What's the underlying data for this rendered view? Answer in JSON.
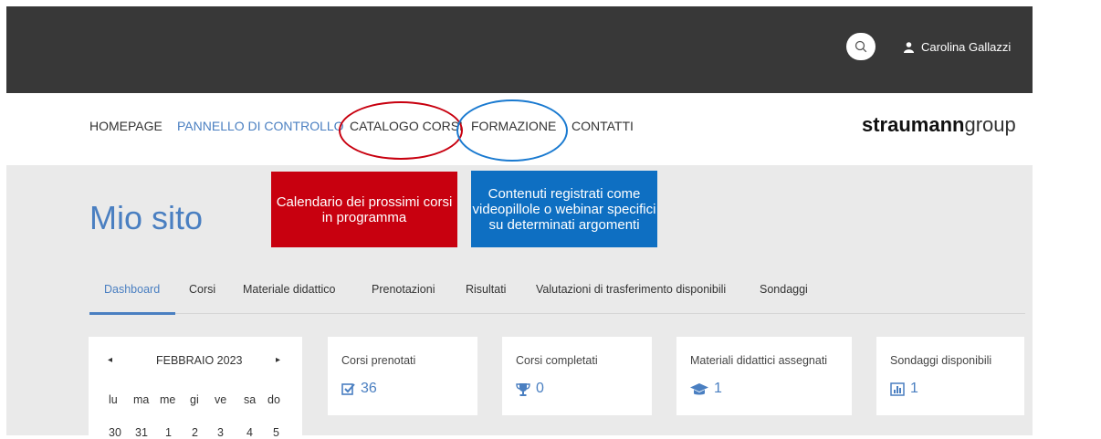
{
  "header": {
    "user_name": "Carolina Gallazzi"
  },
  "nav": {
    "items": [
      "HOMEPAGE",
      "PANNELLO DI CONTROLLO",
      "CATALOGO CORSI",
      "FORMAZIONE",
      "CONTATTI"
    ]
  },
  "logo": {
    "bold": "straumann",
    "light": "group"
  },
  "page": {
    "title": "Mio sito"
  },
  "annotations": {
    "red": "Calendario dei prossimi corsi in programma",
    "blue": "Contenuti registrati come videopillole o webinar specifici su determinati argomenti",
    "red_color": "#c8000f",
    "blue_color": "#0e6fc2"
  },
  "tabs": [
    "Dashboard",
    "Corsi",
    "Materiale didattico",
    "Prenotazioni",
    "Risultati",
    "Valutazioni di trasferimento disponibili",
    "Sondaggi"
  ],
  "calendar": {
    "month": "FEBBRAIO 2023",
    "prev": "◂",
    "next": "▸",
    "weekdays": [
      "lu",
      "ma",
      "me",
      "gi",
      "ve",
      "sa",
      "do"
    ],
    "first_row": [
      "30",
      "31",
      "1",
      "2",
      "3",
      "4",
      "5"
    ]
  },
  "cards": [
    {
      "label": "Corsi prenotati",
      "value": "36",
      "icon": "check-square-icon"
    },
    {
      "label": "Corsi completati",
      "value": "0",
      "icon": "trophy-icon"
    },
    {
      "label": "Materiali didattici assegnati",
      "value": "1",
      "icon": "graduation-cap-icon"
    },
    {
      "label": "Sondaggi disponibili",
      "value": "1",
      "icon": "bar-chart-icon"
    }
  ],
  "colors": {
    "accent": "#4a7fc1",
    "topbar": "#383838",
    "content_bg": "#eaeaea"
  }
}
